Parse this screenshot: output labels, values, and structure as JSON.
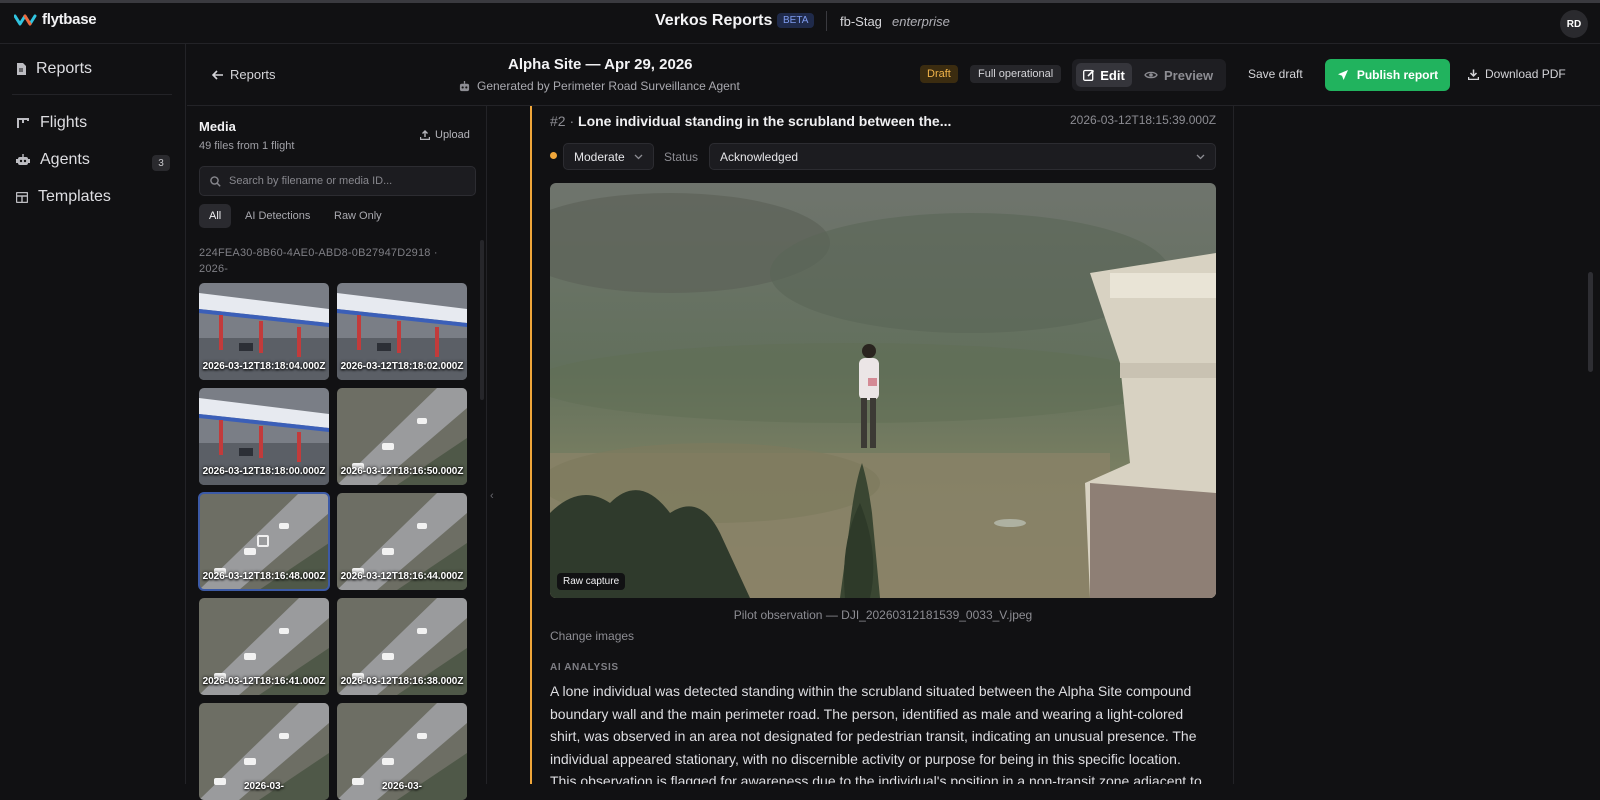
{
  "topbar": {
    "brand": "flytbase",
    "app_title": "Verkos Reports",
    "beta": "BETA",
    "org": "fb-Stag",
    "plan": "enterprise",
    "avatar": "RD"
  },
  "nav": {
    "items": [
      {
        "label": "Reports",
        "icon": "document-icon"
      },
      {
        "label": "Flights",
        "icon": "flights-icon"
      },
      {
        "label": "Agents",
        "icon": "robot-icon",
        "badge": "3"
      },
      {
        "label": "Templates",
        "icon": "templates-icon"
      }
    ]
  },
  "header": {
    "back_label": "Reports",
    "title": "Alpha Site — Apr 29, 2026",
    "generated_by": "Generated by Perimeter Road Surveillance Agent",
    "draft_badge": "Draft",
    "mode_badge": "Full operational",
    "edit_label": "Edit",
    "preview_label": "Preview",
    "save_draft_label": "Save draft",
    "publish_label": "Publish report",
    "download_label": "Download PDF"
  },
  "media": {
    "title": "Media",
    "subtitle": "49 files from 1 flight",
    "upload_label": "Upload",
    "search_placeholder": "Search by filename or media ID...",
    "filters": [
      "All",
      "AI Detections",
      "Raw Only"
    ],
    "active_filter": "All",
    "flight_id": "224FEA30-8B60-4AE0-ABD8-0B27947D2918 · 2026-",
    "thumbnails": [
      {
        "label": "2026-03-12T18:18:04.000Z",
        "scene": "station"
      },
      {
        "label": "2026-03-12T18:18:02.000Z",
        "scene": "station"
      },
      {
        "label": "2026-03-12T18:18:00.000Z",
        "scene": "station"
      },
      {
        "label": "2026-03-12T18:16:50.000Z",
        "scene": "road"
      },
      {
        "label": "2026-03-12T18:16:48.000Z",
        "scene": "road",
        "selected": true
      },
      {
        "label": "2026-03-12T18:16:44.000Z",
        "scene": "road"
      },
      {
        "label": "2026-03-12T18:16:41.000Z",
        "scene": "road"
      },
      {
        "label": "2026-03-12T18:16:38.000Z",
        "scene": "road"
      },
      {
        "label": "2026-03-",
        "scene": "road"
      },
      {
        "label": "2026-03-",
        "scene": "road"
      }
    ]
  },
  "incident": {
    "number": "#2 ·",
    "title": "Lone individual standing in the scrubland between the...",
    "timestamp": "2026-03-12T18:15:39.000Z",
    "severity": "Moderate",
    "severity_color": "#f0a63a",
    "status_label": "Status",
    "status": "Acknowledged",
    "image_badge": "Raw capture",
    "caption": "Pilot observation — DJI_20260312181539_0033_V.jpeg",
    "change_images": "Change images",
    "ai_label": "AI ANALYSIS",
    "ai_text": "A lone individual was detected standing within the scrubland situated between the Alpha Site compound boundary wall and the main perimeter road. The person, identified as male and wearing a light-colored shirt, was observed in an area not designated for pedestrian transit, indicating an unusual presence. The individual appeared stationary, with no discernible activity or purpose for being in this specific location. This observation is flagged for awareness due to the individual's position in a non-transit zone adjacent to"
  },
  "colors": {
    "accent_green": "#21b35e",
    "draft_orange": "#f0b34a",
    "card_accent": "#f0a63a"
  }
}
